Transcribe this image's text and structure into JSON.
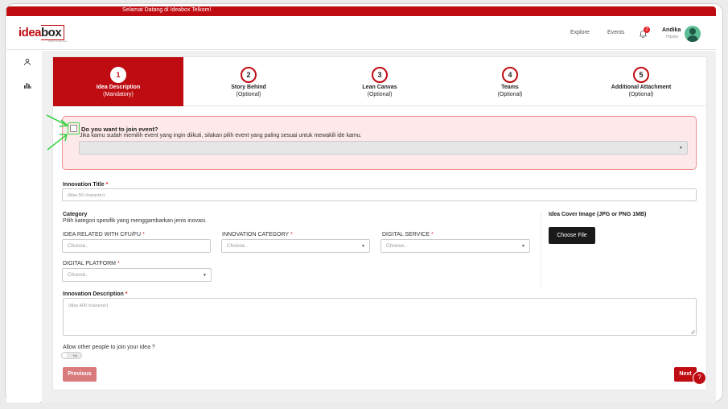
{
  "banner": {
    "text": "Selamat Datang di Ideabox Telkom!"
  },
  "logo": {
    "part1": "idea",
    "part2": "box",
    "sub": "Telkom Indonesia"
  },
  "nav": {
    "explore": "Explore",
    "events": "Events",
    "notif_count": "2"
  },
  "user": {
    "name": "Andika",
    "role": "Hipster"
  },
  "steps": [
    {
      "num": "1",
      "title": "Idea Description",
      "sub": "(Mandatory)",
      "active": true
    },
    {
      "num": "2",
      "title": "Story Behind",
      "sub": "(Optional)"
    },
    {
      "num": "3",
      "title": "Lean Canvas",
      "sub": "(Optional)"
    },
    {
      "num": "4",
      "title": "Teams",
      "sub": "(Optional)"
    },
    {
      "num": "5",
      "title": "Additional Attachment",
      "sub": "(Optional)"
    }
  ],
  "event": {
    "question": "Do you want to join event?",
    "hint": "Jika kamu sudah memilih event yang ingin diikuti, silakan pilih event yang paling sesuai untuk mewakili ide kamu.",
    "checked": false
  },
  "form": {
    "title_label": "Innovation Title",
    "title_placeholder": "(Max.50 character)",
    "category_label": "Category",
    "category_hint": "Pilih kategori spesifik yang menggambarkan jenis inovasi.",
    "cfu_label": "IDEA RELATED WITH CFU/FU",
    "cfu_placeholder": "Choose..",
    "innov_cat_label": "INNOVATION CATEGORY",
    "innov_cat_value": "Choose..",
    "digital_service_label": "DIGITAL SERVICE",
    "digital_service_value": "Choose..",
    "digital_platform_label": "DIGITAL PLATFORM",
    "digital_platform_value": "Choose..",
    "cover_label": "Idea Cover Image (JPG or PNG 1MB)",
    "choose_file": "Choose File",
    "desc_label": "Innovation Description",
    "desc_placeholder": "(Max.400 character)",
    "allow_label": "Allow other people to join your idea ?",
    "allow_value": "No",
    "required_mark": "*"
  },
  "actions": {
    "previous": "Previous",
    "next": "Next",
    "help": "?"
  },
  "colors": {
    "brand": "#bf0c12",
    "highlight": "#3cd44a"
  }
}
